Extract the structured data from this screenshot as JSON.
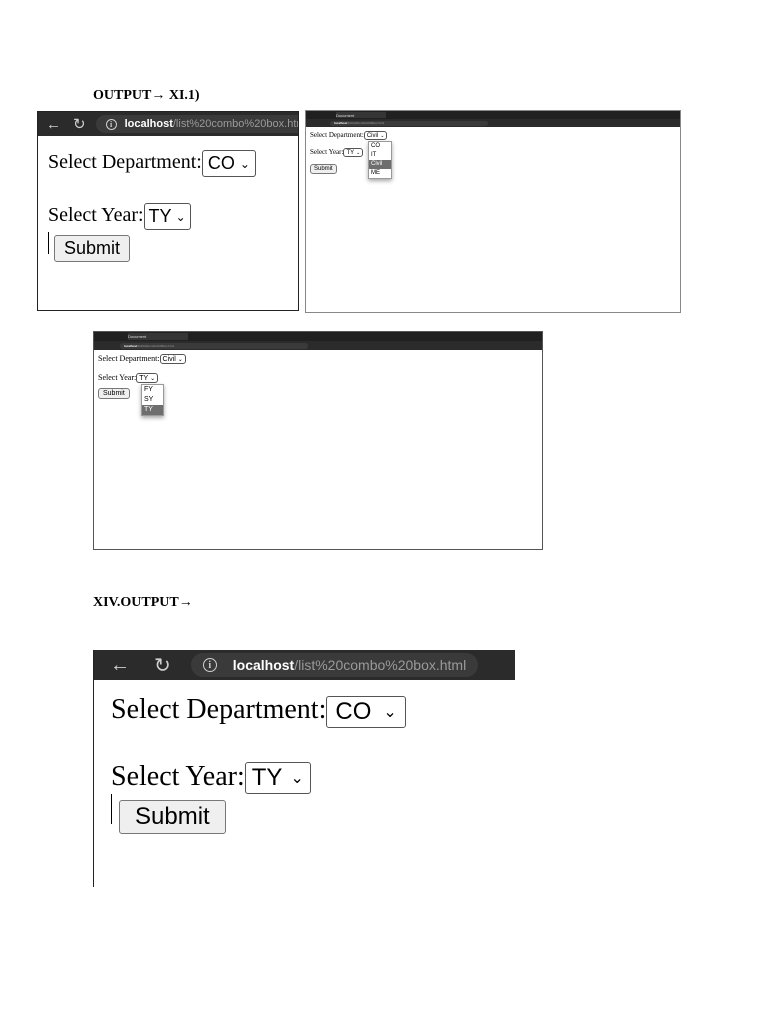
{
  "headings": {
    "output1": "OUTPUT→ XI.1)",
    "output2": "XIV.OUTPUT→"
  },
  "browser": {
    "url_host": "localhost",
    "url_path": "/list%20combo%20box.html",
    "tab_title": "Document",
    "info_glyph": "i"
  },
  "form": {
    "department_label": "Select Department:",
    "year_label": "Select Year:",
    "submit_label": "Submit"
  },
  "screens": {
    "s1": {
      "department": "CO",
      "year": "TY"
    },
    "s2": {
      "department": "Civil",
      "year": "TY",
      "dept_options": [
        "CO",
        "IT",
        "Civil",
        "ME"
      ],
      "highlight": "Civil"
    },
    "s3": {
      "department": "Civil",
      "year": "TY",
      "year_options": [
        "FY",
        "SY",
        "TY"
      ],
      "highlight": "TY"
    },
    "s4": {
      "department": "CO",
      "year": "TY"
    }
  }
}
